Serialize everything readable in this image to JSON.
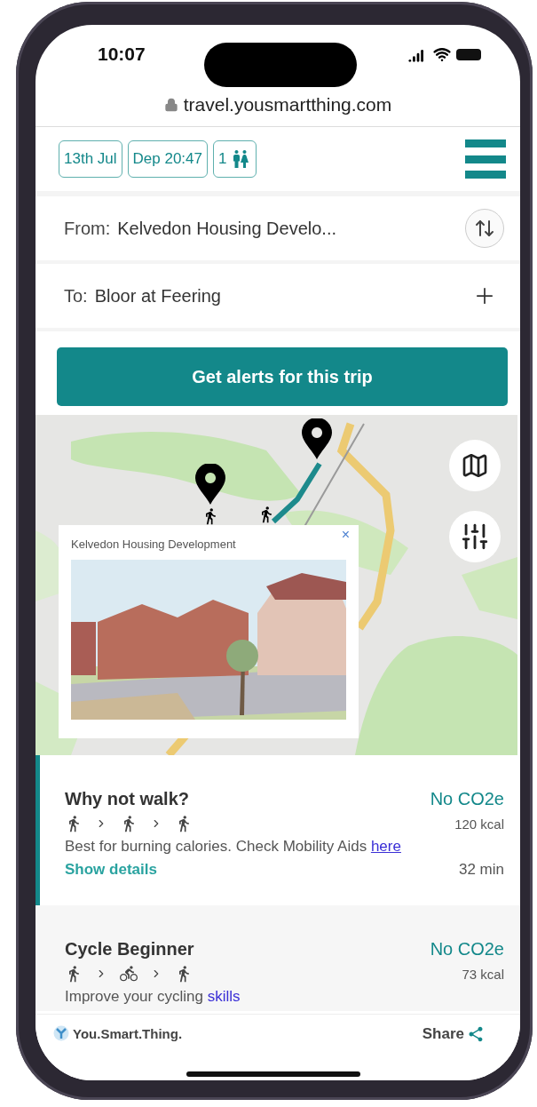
{
  "status_bar": {
    "time": "10:07"
  },
  "browser": {
    "url": "travel.yousmartthing.com"
  },
  "trip_options": [
    {
      "label": "13th Jul",
      "kind": "text"
    },
    {
      "label": "Dep 20:47",
      "kind": "text"
    },
    {
      "label": "1",
      "kind": "passengers"
    }
  ],
  "from": {
    "label": "From:",
    "value": "Kelvedon Housing Develo..."
  },
  "to": {
    "label": "To:",
    "value": "Bloor at Feering"
  },
  "alert_button": "Get alerts for this trip",
  "map": {
    "kind": "picture",
    "popup": {
      "title": "Kelvedon Housing Development",
      "close": "×"
    }
  },
  "routes": [
    {
      "title": "Why not walk?",
      "emissions": "No CO2e",
      "calories": "120 kcal",
      "legs": [
        {
          "kind": "walk"
        },
        {
          "kind": "walk"
        },
        {
          "kind": "walk"
        }
      ],
      "description": "Best for burning calories. Check Mobility Aids",
      "link": "here",
      "details": "Show details",
      "duration": "32 min",
      "selected": true
    },
    {
      "title": "Cycle Beginner",
      "emissions": "No CO2e",
      "calories": "73 kcal",
      "legs": [
        {
          "kind": "walk"
        },
        {
          "kind": "bike"
        },
        {
          "kind": "walk"
        }
      ],
      "description": "Improve your cycling",
      "link": "skills",
      "selected": false
    }
  ],
  "footer": {
    "brand": "You.Smart.Thing.",
    "share": "Share"
  }
}
